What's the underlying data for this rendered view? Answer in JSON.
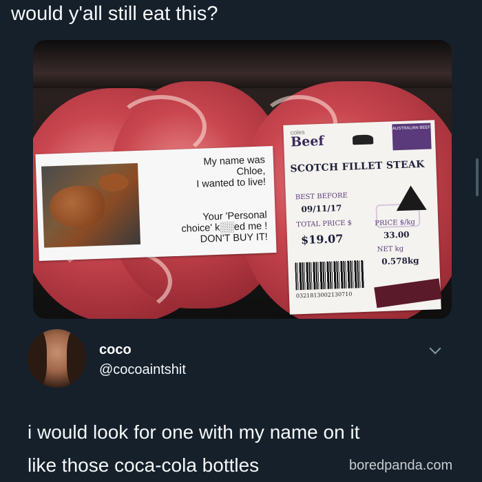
{
  "post": {
    "caption": "would y'all still eat this?",
    "photo": {
      "left_label": {
        "line1": "My name was",
        "line2": "Chloe,",
        "line3": "I wanted to live!",
        "line4": "Your 'Personal",
        "line5": "choice' k░░ed me !",
        "line6": "DON'T BUY IT!"
      },
      "right_label": {
        "brand_small": "coles",
        "brand": "Beef",
        "badge": "AUSTRALIAN BEEF",
        "product": "SCOTCH FILLET STEAK",
        "best_before_label": "BEST BEFORE",
        "best_before_value": "09/11/17",
        "total_price_label": "TOTAL PRICE $",
        "total_price_value": "$19.07",
        "price_per_kg_label": "PRICE $/kg",
        "price_per_kg_value": "33.00",
        "net_kg_label": "NET kg",
        "net_kg_value": "0.578kg",
        "barcode_number": "0321813002130710"
      }
    }
  },
  "reply": {
    "display_name": "coco",
    "handle": "@cocoaintshit",
    "text_line1": "i would look for one with my name on it",
    "text_line2": "like those coca-cola bottles"
  },
  "watermark": "boredpanda.com",
  "icons": {
    "menu": "chevron-down-icon",
    "label_logo": "cow-icon",
    "certification": "triangle-logo-icon"
  },
  "colors": {
    "background": "#15202b",
    "text": "#f5f8fa",
    "secondary": "#8899a6",
    "label_purple": "#5a3a7a"
  }
}
